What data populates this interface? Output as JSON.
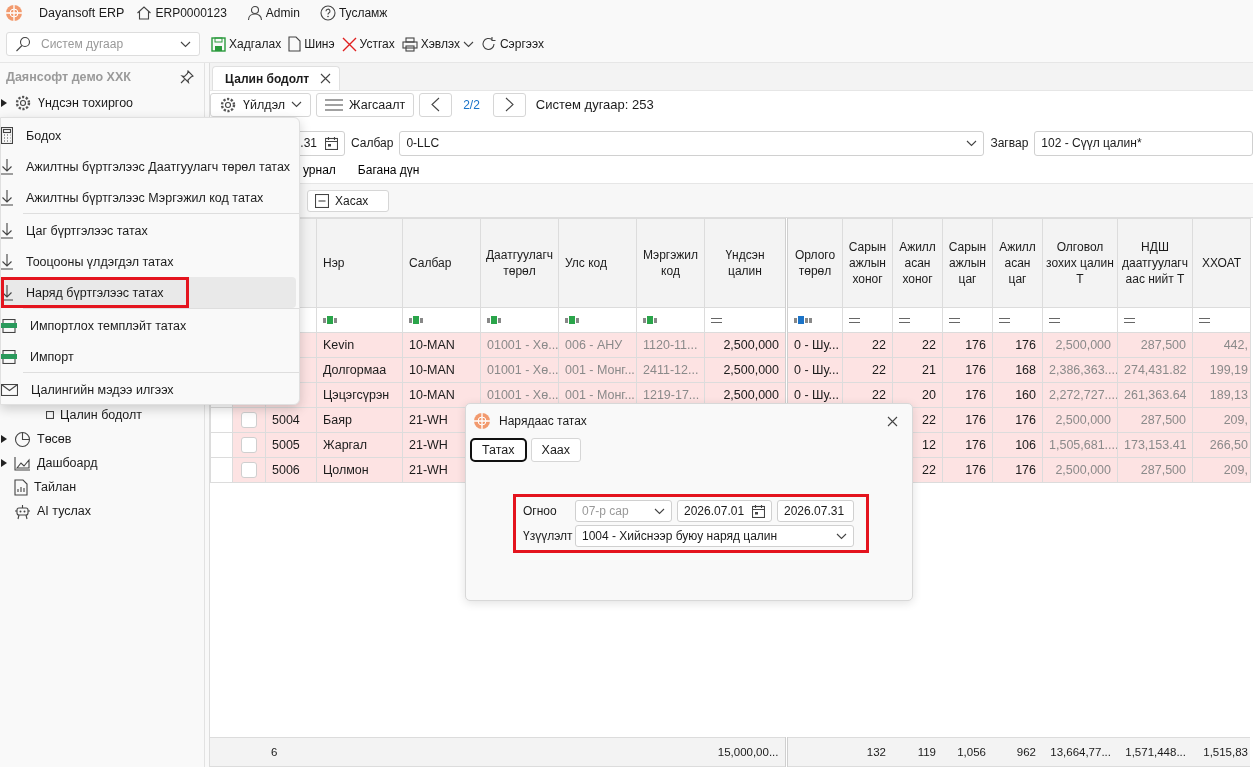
{
  "app": {
    "title": "Dayansoft ERP",
    "database": "ERP0000123",
    "user": "Admin",
    "help": "Тусламж"
  },
  "search": {
    "placeholder": "Систем дугаар"
  },
  "toolbar": [
    {
      "label": "Хадгалах",
      "kind": "save"
    },
    {
      "label": "Шинэ",
      "kind": "new"
    },
    {
      "label": "Устгах",
      "kind": "delete"
    },
    {
      "label": "Хэвлэх",
      "kind": "print"
    },
    {
      "label": "Сэргээх",
      "kind": "refresh"
    }
  ],
  "sidebar": {
    "title": "Даянсофт демо ХХК",
    "items": [
      {
        "label": "Үндсэн тохиргоо",
        "kind": "settings",
        "expanded": false
      },
      {
        "children": [
          {
            "label": "Цалин бодолт",
            "kind": "page"
          }
        ]
      },
      {
        "label": "Төсөв",
        "kind": "budget",
        "expanded": false
      },
      {
        "label": "Дашбоард",
        "kind": "dashboard",
        "expanded": false
      },
      {
        "label": "Тайлан",
        "kind": "report"
      },
      {
        "label": "AI туслах",
        "kind": "assistant"
      }
    ]
  },
  "document_tab": {
    "label": "Цалин бодолт"
  },
  "actions": {
    "action_button": "Үйлдэл",
    "list_button": "Жагсаалт",
    "page": "2/2",
    "system_number": "Систем дугаар: 253"
  },
  "filters": {
    "date_end": ".31",
    "branch_label": "Салбар",
    "branch": "0-LLC",
    "template_label": "Загвар",
    "template": "102 - Сүүл цалин*"
  },
  "sub_tabs": [
    {
      "label": "урнал"
    },
    {
      "label": "Багана дүн"
    }
  ],
  "remove_button": "Хасах",
  "table": {
    "columns": [
      {
        "label": "Нэр",
        "kind": "text",
        "readonly": false
      },
      {
        "label": "Салбар",
        "kind": "text",
        "readonly": false
      },
      {
        "label": "Даатгуулагч төрөл",
        "kind": "text",
        "readonly": true
      },
      {
        "label": "Улс код",
        "kind": "text",
        "readonly": true
      },
      {
        "label": "Мэргэжил код",
        "kind": "text",
        "readonly": true
      },
      {
        "label": "Үндсэн цалин",
        "kind": "number",
        "readonly": false
      },
      {
        "label": "Орлого төрөл",
        "kind": "code",
        "readonly": false
      },
      {
        "label": "Сарын ажлын хоног",
        "kind": "number",
        "readonly": false
      },
      {
        "label": "Ажилласан хоног",
        "kind": "number",
        "readonly": false
      },
      {
        "label": "Сарын ажлын цаг",
        "kind": "number",
        "readonly": false
      },
      {
        "label": "Ажилласан цаг",
        "kind": "number",
        "readonly": false
      },
      {
        "label": "Олговол зохих цалин Т",
        "kind": "number",
        "readonly": true
      },
      {
        "label": "НДШ даатгуулагчаас нийт Т",
        "kind": "number",
        "readonly": true
      },
      {
        "label": "ХХОАТ",
        "kind": "number",
        "readonly": true
      }
    ],
    "rows": [
      {
        "cells": [
          "Kevin",
          "10-MAN",
          "01001 - Хө...",
          "006 - АНУ",
          "1120-11...",
          "2,500,000",
          "0 - Шу...",
          "22",
          "22",
          "176",
          "176",
          "2,500,000",
          "287,500",
          "442,"
        ]
      },
      {
        "cells": [
          "Долгормаа",
          "10-MAN",
          "01001 - Хө...",
          "001 - Монг...",
          "2411-12...",
          "2,500,000",
          "0 - Шу...",
          "22",
          "21",
          "176",
          "168",
          "2,386,363....",
          "274,431.82",
          "199,19"
        ]
      },
      {
        "cells": [
          "Цэцэгсүрэн",
          "10-MAN",
          "01001 - Хө...",
          "001 - Монг...",
          "1219-17...",
          "2,500,000",
          "0 - Шу...",
          "22",
          "20",
          "176",
          "160",
          "2,272,727....",
          "261,363.64",
          "189,13"
        ]
      },
      {
        "checked": false,
        "code": "5004",
        "cells": [
          "Баяр",
          "21-WH",
          null,
          null,
          null,
          null,
          null,
          null,
          "22",
          "176",
          "176",
          "2,500,000",
          "287,500",
          "209,"
        ]
      },
      {
        "checked": false,
        "code": "5005",
        "cells": [
          "Жаргал",
          "21-WH",
          null,
          null,
          null,
          null,
          null,
          null,
          "12",
          "176",
          "106",
          "1,505,681....",
          "173,153.41",
          "266,50"
        ]
      },
      {
        "checked": false,
        "code": "5006",
        "cells": [
          "Цолмон",
          "21-WH",
          null,
          null,
          null,
          null,
          null,
          null,
          "22",
          "176",
          "176",
          "2,500,000",
          "287,500",
          "209,"
        ]
      }
    ],
    "footer": {
      "code": "6",
      "cells": [
        null,
        null,
        null,
        null,
        null,
        "15,000,00...",
        null,
        "132",
        "119",
        "1,056",
        "962",
        "13,664,77...",
        "1,571,448...",
        "1,515,83"
      ]
    }
  },
  "action_menu": {
    "items": [
      {
        "label": "Бодох",
        "kind": "calculate",
        "hovered": false,
        "annotated": false
      },
      {
        "label": "Ажилтны бүртгэлээс Даатгуулагч төрөл татах",
        "kind": "download",
        "hovered": false,
        "annotated": false
      },
      {
        "label": "Ажилтны бүртгэлээс Мэргэжил код татах",
        "kind": "download",
        "hovered": false,
        "annotated": false
      },
      {
        "kind": "separator"
      },
      {
        "label": "Цаг бүртгэлээс татах",
        "kind": "download",
        "hovered": false,
        "annotated": false
      },
      {
        "label": "Тооцооны үлдэгдэл татах",
        "kind": "download",
        "hovered": false,
        "annotated": false
      },
      {
        "label": "Наряд бүртгэлээс татах",
        "kind": "download",
        "hovered": true,
        "annotated": true
      },
      {
        "kind": "separator"
      },
      {
        "label": "Импортлох темплэйт татах",
        "kind": "spreadsheet",
        "hovered": false,
        "annotated": false
      },
      {
        "label": "Импорт",
        "kind": "spreadsheet",
        "hovered": false,
        "annotated": false
      },
      {
        "kind": "separator"
      },
      {
        "label": "Цалингийн мэдээ илгээх",
        "kind": "mail",
        "hovered": false,
        "annotated": false
      }
    ]
  },
  "dialog": {
    "title": "Нарядаас татах",
    "buttons": [
      {
        "label": "Татах",
        "focused": true
      },
      {
        "label": "Хаах",
        "focused": false
      }
    ],
    "form": {
      "annotated": true,
      "date_label": "Огноо",
      "month": "07-р сар",
      "month_disabled": true,
      "date_from": "2026.07.01",
      "date_to": "2026.07.31",
      "indicator_label": "Үзүүлэлт",
      "indicator": "1004 - Хийснээр буюу наряд цалин"
    }
  }
}
